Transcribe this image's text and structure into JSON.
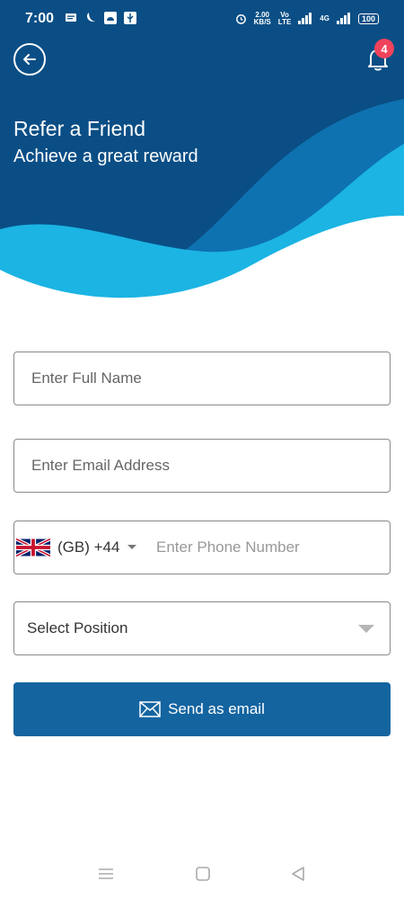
{
  "status_bar": {
    "time": "7:00",
    "net_speed_value": "2.00",
    "net_speed_unit": "KB/S",
    "volte_top": "Vo",
    "volte_bottom": "LTE",
    "signal_label": "4G",
    "battery": "100"
  },
  "header": {
    "title": "Refer a Friend",
    "subtitle": "Achieve a great reward",
    "notification_count": "4"
  },
  "form": {
    "full_name_placeholder": "Enter Full Name",
    "email_placeholder": "Enter Email Address",
    "country_code": "(GB) +44",
    "phone_placeholder": "Enter Phone Number",
    "position_label": "Select Position",
    "send_button_label": "Send as email"
  },
  "colors": {
    "header_dark": "#0a4e85",
    "wave_mid": "#0e72b0",
    "wave_light": "#1bb4e3",
    "button": "#1464a0",
    "badge": "#f0435b"
  },
  "icons": {
    "back": "arrow-left-circle-icon",
    "notification": "bell-icon",
    "flag": "uk-flag-icon",
    "send": "envelope-icon"
  }
}
